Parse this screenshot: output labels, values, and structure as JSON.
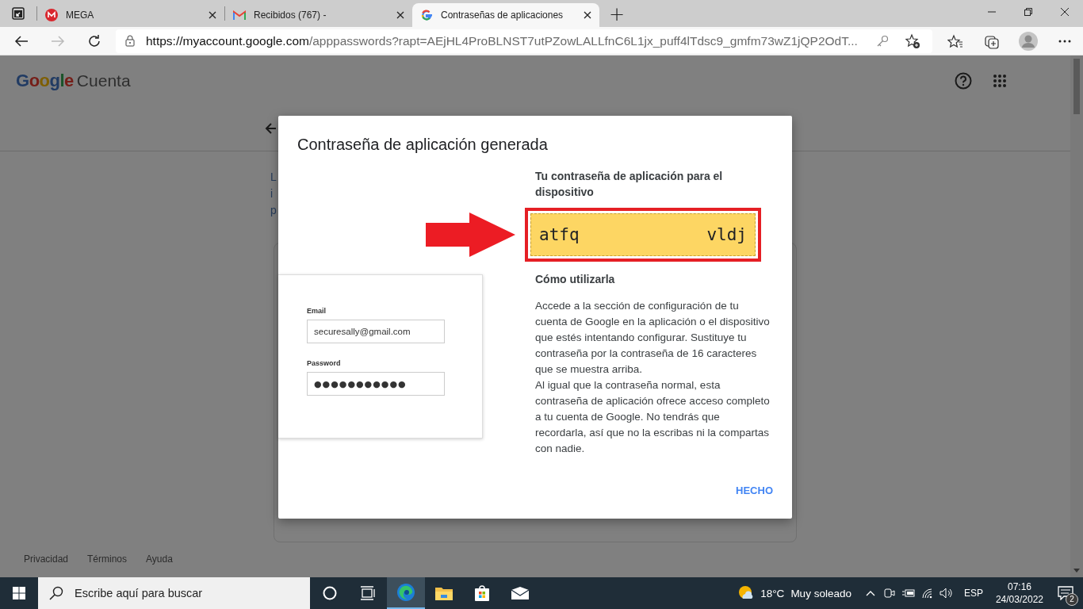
{
  "browser": {
    "tabs": [
      {
        "title": "MEGA",
        "selected": false
      },
      {
        "title": "Recibidos (767) -",
        "selected": false
      },
      {
        "title": "Contraseñas de aplicaciones",
        "selected": true
      }
    ],
    "new_tab": "+",
    "url_host": "https://myaccount.google.com",
    "url_rest": "/apppasswords?rapt=AEjHL4ProBLNST7utPZowLALLfnC6L1jx_puff4lTdsc9_gmfm73wZ1jQP2OdT..."
  },
  "page": {
    "logo": "Google",
    "product": "Cuenta",
    "fragments": [
      "L",
      "i",
      "p"
    ],
    "footer_links": [
      "Privacidad",
      "Términos",
      "Ayuda"
    ]
  },
  "dialog": {
    "title": "Contraseña de aplicación generada",
    "illustration": {
      "email_label": "Email",
      "email_value": "securesally@gmail.com",
      "password_label": "Password",
      "password_mask": "●●●●●●●●●●●"
    },
    "password_heading": "Tu contraseña de aplicación para el dispositivo",
    "password_groups": [
      "atfq",
      "vldj"
    ],
    "howto_heading": "Cómo utilizarla",
    "paragraphs": [
      "Accede a la sección de configuración de tu cuenta de Google en la aplicación o el dispositivo que estés intentando configurar. Sustituye tu contraseña por la contraseña de 16 caracteres que se muestra arriba.",
      "Al igual que la contraseña normal, esta contraseña de aplicación ofrece acceso completo a tu cuenta de Google. No tendrás que recordarla, así que no la escribas ni la compartas con nadie."
    ],
    "button": "HECHO"
  },
  "taskbar": {
    "search_placeholder": "Escribe aquí para buscar",
    "apps": [
      {
        "kind": "cortana",
        "selected": false
      },
      {
        "kind": "taskview",
        "selected": false
      },
      {
        "kind": "edge",
        "selected": true
      },
      {
        "kind": "explorer",
        "selected": false
      },
      {
        "kind": "store",
        "selected": false
      },
      {
        "kind": "mail",
        "selected": false
      }
    ],
    "temperature": "18°C",
    "weather": "Muy soleado",
    "language": "ESP",
    "time": "07:16",
    "date": "24/03/2022",
    "notifications": "2"
  }
}
